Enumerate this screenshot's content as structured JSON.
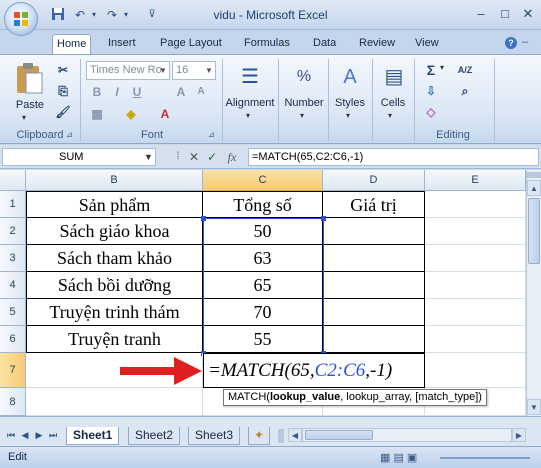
{
  "window": {
    "title": "vidu - Microsoft Excel"
  },
  "tabs": [
    "Home",
    "Insert",
    "Page Layout",
    "Formulas",
    "Data",
    "Review",
    "View"
  ],
  "ribbon": {
    "clipboard": {
      "paste": "Paste",
      "label": "Clipboard"
    },
    "font": {
      "name": "Times New Ro",
      "size": "16",
      "bold": "B",
      "italic": "I",
      "underline": "U",
      "label": "Font"
    },
    "alignment": "Alignment",
    "number": "Number",
    "styles": "Styles",
    "cells": "Cells",
    "editing": {
      "label": "Editing",
      "sum": "Σ",
      "sort": "A/Z"
    }
  },
  "formula_bar": {
    "name_box": "SUM",
    "fx": "fx",
    "formula": "=MATCH(65,C2:C6,-1)"
  },
  "sheet": {
    "columns": [
      "B",
      "C",
      "D",
      "E"
    ],
    "rows": [
      "1",
      "2",
      "3",
      "4",
      "5",
      "6",
      "7",
      "8"
    ],
    "header": {
      "product": "Sản phẩm",
      "total": "Tổng số",
      "value": "Giá trị"
    },
    "data": [
      {
        "product": "Sách giáo khoa",
        "total": "50"
      },
      {
        "product": "Sách tham khảo",
        "total": "63"
      },
      {
        "product": "Sách bồi dưỡng",
        "total": "65"
      },
      {
        "product": "Truyện trinh thám",
        "total": "70"
      },
      {
        "product": "Truyện tranh",
        "total": "55"
      }
    ],
    "edit_cell": {
      "prefix": "=MATCH(65,",
      "ref": "C2:C6",
      "suffix": ",-1)"
    },
    "tooltip": {
      "fn": "MATCH(",
      "arg1": "lookup_value",
      "rest": ", lookup_array, [match_type])"
    }
  },
  "sheet_tabs": [
    "Sheet1",
    "Sheet2",
    "Sheet3"
  ],
  "status": "Edit",
  "colors": {
    "arrow": "#e02020",
    "ref_blue": "#2a52d8",
    "selection": "#f7c972"
  }
}
